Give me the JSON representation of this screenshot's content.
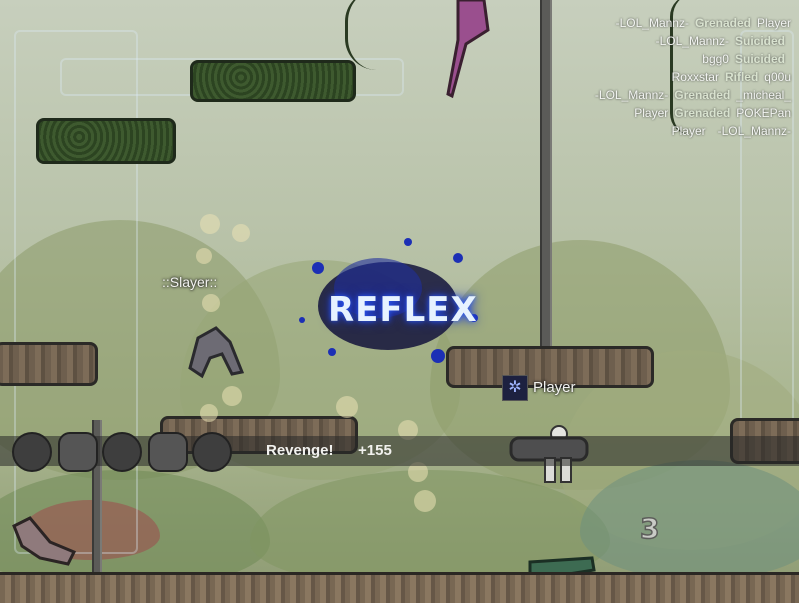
{
  "killfeed": [
    {
      "killer": "-LOL_Mannz-",
      "weapon": "Grenaded",
      "victim": "Player"
    },
    {
      "killer": "-LOL_Mannz-",
      "weapon": "Suicided",
      "victim": ""
    },
    {
      "killer": "bgg0",
      "weapon": "Suicided",
      "victim": ""
    },
    {
      "killer": "Roxxstar",
      "weapon": "Rifled",
      "victim": "q00u"
    },
    {
      "killer": "-LOL_Mannz-",
      "weapon": "Grenaded",
      "victim": "_micheal_"
    },
    {
      "killer": "Player",
      "weapon": "Grenaded",
      "victim": "POKEPan"
    },
    {
      "killer": "Player",
      "weapon": "",
      "victim": "-LOL_Mannz-"
    }
  ],
  "splash": {
    "text": "REFLEX"
  },
  "players": {
    "enemy_name": "::Slayer::",
    "self_name": "Player"
  },
  "hud": {
    "revenge_label": "Revenge!",
    "bonus_points": "+155",
    "counter": "3"
  },
  "colors": {
    "splash_blue": "#1c2fb5",
    "hud_text": "#f1f1ee"
  }
}
